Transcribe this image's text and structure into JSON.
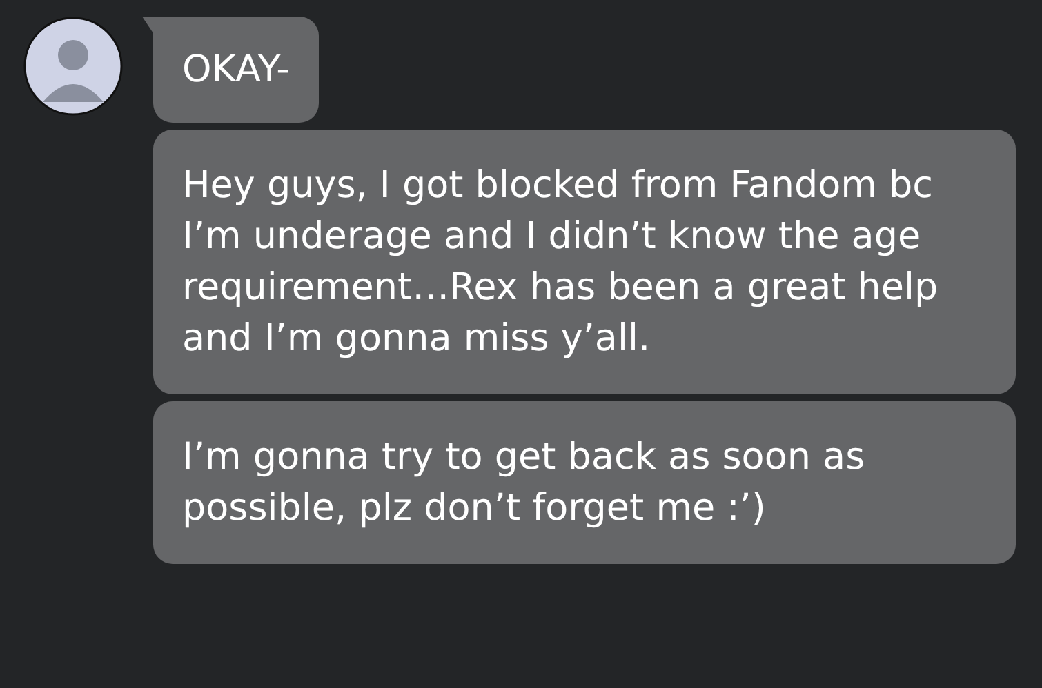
{
  "messages": [
    {
      "text": "OKAY-",
      "first": true
    },
    {
      "text": "Hey guys, I got blocked from Fandom bc I’m underage and I didn’t know the age requirement…Rex has been a great help and I’m gonna miss y’all.",
      "first": false
    },
    {
      "text": "I’m gonna try to get back as soon as possible, plz don’t forget me :’)",
      "first": false
    }
  ]
}
